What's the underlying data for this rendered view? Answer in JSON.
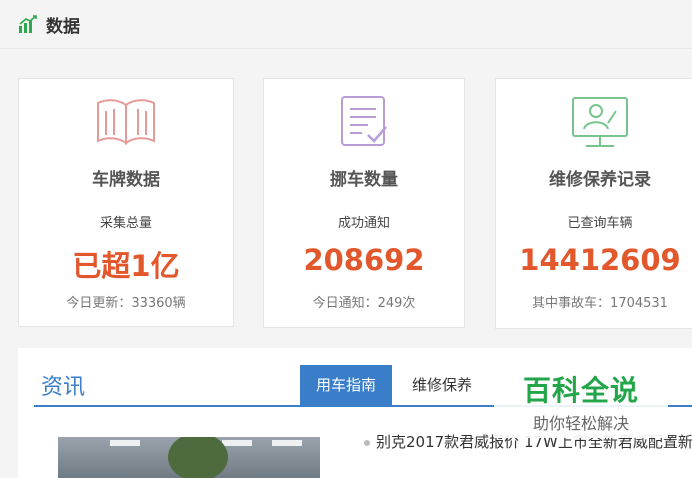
{
  "header": {
    "title": "数据",
    "icon": "bar-chart-icon"
  },
  "cards": [
    {
      "icon": "open-book-icon",
      "name": "车牌数据",
      "sub": "采集总量",
      "value": "已超1亿",
      "foot": "今日更新：33360辆"
    },
    {
      "icon": "checklist-icon",
      "name": "挪车数量",
      "sub": "成功通知",
      "value": "208692",
      "foot": "今日通知：249次"
    },
    {
      "icon": "monitor-user-icon",
      "name": "维修保养记录",
      "sub": "已查询车辆",
      "value": "14412609",
      "foot": "其中事故车：1704531"
    }
  ],
  "news": {
    "title": "资讯",
    "tabs": [
      {
        "label": "用车指南",
        "active": true
      },
      {
        "label": "维修保养",
        "active": false
      }
    ],
    "headline": "别克2017款君威报价 17W上市全新君威配置新"
  },
  "watermark": {
    "main": "百科全说",
    "sub": "助你轻松解决"
  },
  "colors": {
    "accent": "#3a7dc9",
    "number": "#e2572c",
    "green": "#23a64a"
  }
}
